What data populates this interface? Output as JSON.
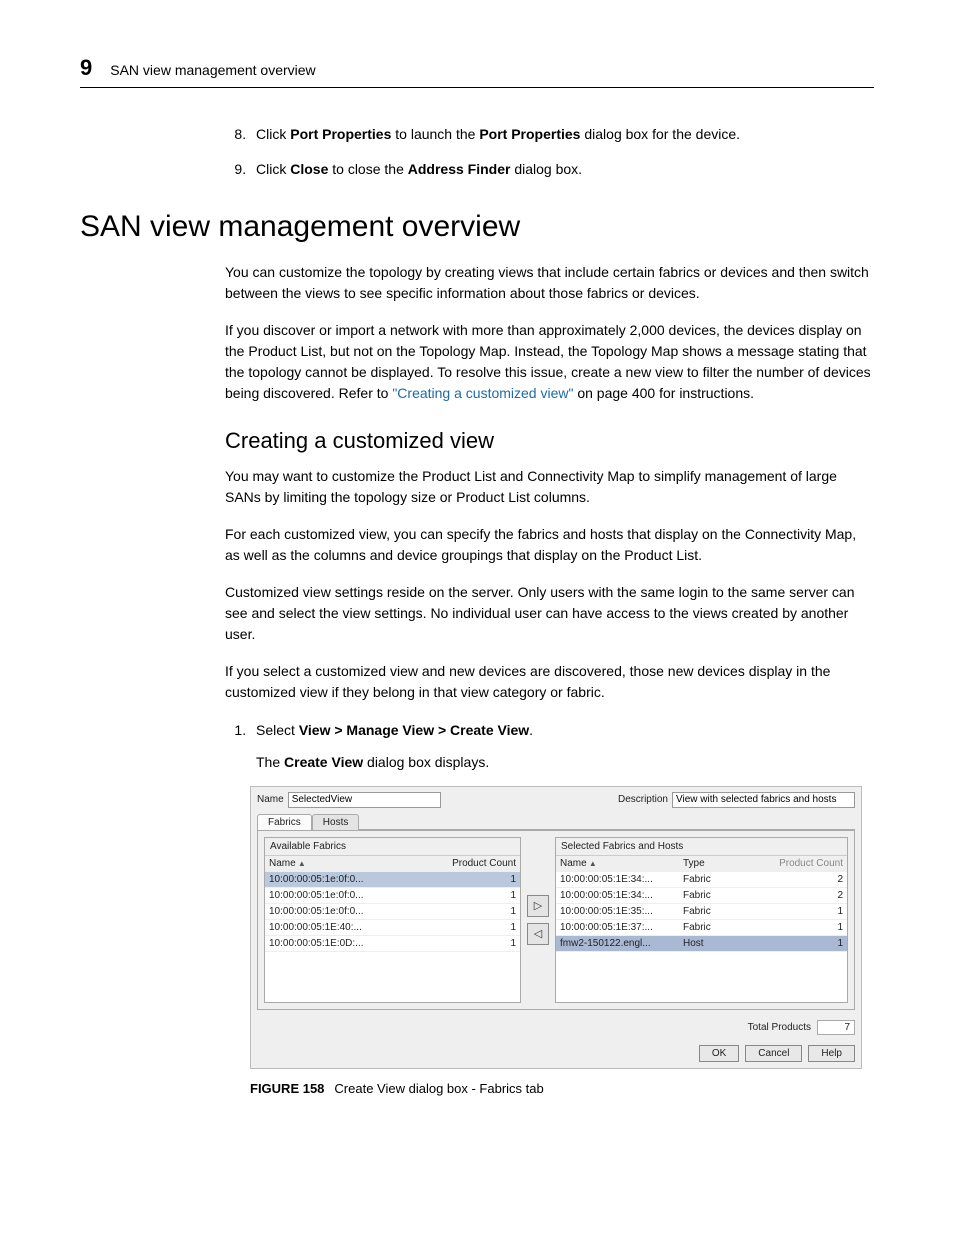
{
  "header": {
    "chapter_number": "9",
    "running_title": "SAN view management overview"
  },
  "steps_top": [
    {
      "n": "8.",
      "prefix": "Click ",
      "bold1": "Port Properties",
      "mid": " to launch the ",
      "bold2": "Port Properties",
      "suffix": " dialog box for the device."
    },
    {
      "n": "9.",
      "prefix": "Click ",
      "bold1": "Close",
      "mid": " to close the ",
      "bold2": "Address Finder",
      "suffix": " dialog box."
    }
  ],
  "section_title": "SAN view management overview",
  "paras1": [
    "You can customize the topology by creating views that include certain fabrics or devices and then switch between the views to see specific information about those fabrics or devices."
  ],
  "para_link": {
    "pre": "If you discover or import a network with more than approximately 2,000 devices, the devices display on the Product List, but not on the Topology Map. Instead, the Topology Map shows a message stating that the topology cannot be displayed. To resolve this issue, create a new view to filter the number of devices being discovered. Refer to ",
    "link": "\"Creating a customized view\"",
    "post": " on page 400 for instructions."
  },
  "subhead": "Creating a customized view",
  "paras2": [
    "You may want to customize the Product List and Connectivity Map to simplify management of large SANs by limiting the topology size or Product List columns.",
    "For each customized view, you can specify the fabrics and hosts that display on the Connectivity Map, as well as the columns and device groupings that display on the Product List.",
    "Customized view settings reside on the server. Only users with the same login to the same server can see and select the view settings. No individual user can have access to the views created by another user.",
    "If you select a customized view and new devices are discovered, those new devices display in the customized view if they belong in that view category or fabric."
  ],
  "step1": {
    "prefix": "Select ",
    "bold": "View > Manage View > Create View",
    "suffix": ".",
    "after_pre": "The ",
    "after_bold": "Create View",
    "after_post": " dialog box displays."
  },
  "dialog": {
    "name_label": "Name",
    "name_value": "SelectedView",
    "desc_label": "Description",
    "desc_value": "View with selected fabrics and hosts",
    "tabs": [
      "Fabrics",
      "Hosts"
    ],
    "left_title": "Available Fabrics",
    "left_columns": [
      "Name",
      "Product Count"
    ],
    "left_rows": [
      {
        "name": "10:00:00:05:1e:0f:0...",
        "count": "1",
        "sel": true
      },
      {
        "name": "10:00:00:05:1e:0f:0...",
        "count": "1"
      },
      {
        "name": "10:00:00:05:1e:0f:0...",
        "count": "1"
      },
      {
        "name": "10:00:00:05:1E:40:...",
        "count": "1"
      },
      {
        "name": "10:00:00:05:1E:0D:...",
        "count": "1"
      }
    ],
    "right_title": "Selected Fabrics and Hosts",
    "right_columns": [
      "Name",
      "Type",
      "Product Count"
    ],
    "right_rows": [
      {
        "name": "10:00:00:05:1E:34:...",
        "type": "Fabric",
        "count": "2"
      },
      {
        "name": "10:00:00:05:1E:34:...",
        "type": "Fabric",
        "count": "2"
      },
      {
        "name": "10:00:00:05:1E:35:...",
        "type": "Fabric",
        "count": "1"
      },
      {
        "name": "10:00:00:05:1E:37:...",
        "type": "Fabric",
        "count": "1"
      },
      {
        "name": "fmw2-150122.engl...",
        "type": "Host",
        "count": "1",
        "sel": true
      }
    ],
    "totals_label": "Total Products",
    "totals_value": "7",
    "buttons": [
      "OK",
      "Cancel",
      "Help"
    ]
  },
  "figure": {
    "label": "FIGURE 158",
    "caption": "Create View dialog box - Fabrics tab"
  }
}
